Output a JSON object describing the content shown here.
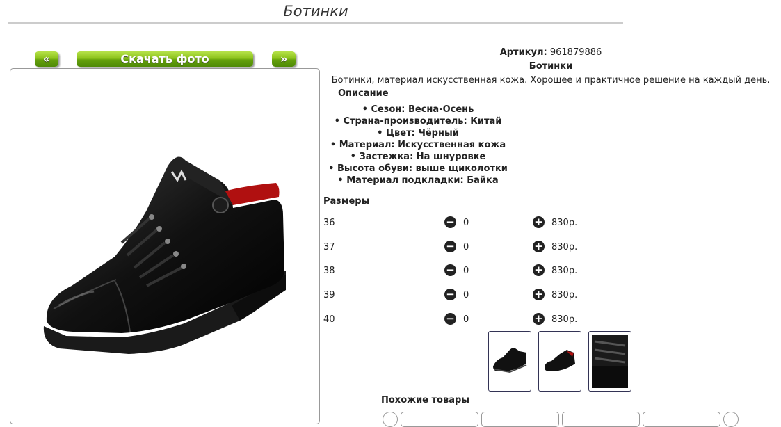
{
  "page": {
    "title": "Ботинки"
  },
  "nav": {
    "prev_label": "«",
    "download_label": "Скачать фото",
    "next_label": "»"
  },
  "product": {
    "article_label": "Артикул:",
    "article_value": "961879886",
    "name": "Ботинки",
    "description": "Ботинки, материал искусственная кожа. Хорошее и практичное решение на каждый день.",
    "description_heading": "Описание",
    "specs": [
      "Сезон: Весна-Осень",
      "Страна-производитель: Китай",
      "Цвет: Чёрный",
      "Материал: Искусственная кожа",
      "Застежка: На шнуровке",
      "Высота обуви: выше щиколотки",
      "Материал подкладки: Байка"
    ]
  },
  "sizes": {
    "heading": "Размеры",
    "rows": [
      {
        "size": "36",
        "qty": "0",
        "price": "830р."
      },
      {
        "size": "37",
        "qty": "0",
        "price": "830р."
      },
      {
        "size": "38",
        "qty": "0",
        "price": "830р."
      },
      {
        "size": "39",
        "qty": "0",
        "price": "830р."
      },
      {
        "size": "40",
        "qty": "0",
        "price": "830р."
      }
    ]
  },
  "similar": {
    "heading": "Похожие товары"
  },
  "icons": {
    "minus": "minus-circle-icon",
    "plus": "plus-circle-icon"
  },
  "colors": {
    "button_green": "#7cb518",
    "icon_dark": "#222222",
    "thumb_border": "#333355"
  }
}
